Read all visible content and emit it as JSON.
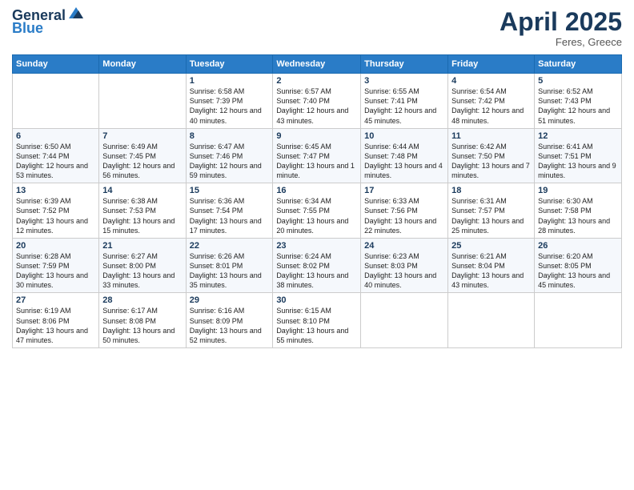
{
  "header": {
    "logo_line1": "General",
    "logo_line2": "Blue",
    "month_title": "April 2025",
    "location": "Feres, Greece"
  },
  "weekdays": [
    "Sunday",
    "Monday",
    "Tuesday",
    "Wednesday",
    "Thursday",
    "Friday",
    "Saturday"
  ],
  "rows": [
    [
      {
        "day": "",
        "info": ""
      },
      {
        "day": "",
        "info": ""
      },
      {
        "day": "1",
        "info": "Sunrise: 6:58 AM\nSunset: 7:39 PM\nDaylight: 12 hours and 40 minutes."
      },
      {
        "day": "2",
        "info": "Sunrise: 6:57 AM\nSunset: 7:40 PM\nDaylight: 12 hours and 43 minutes."
      },
      {
        "day": "3",
        "info": "Sunrise: 6:55 AM\nSunset: 7:41 PM\nDaylight: 12 hours and 45 minutes."
      },
      {
        "day": "4",
        "info": "Sunrise: 6:54 AM\nSunset: 7:42 PM\nDaylight: 12 hours and 48 minutes."
      },
      {
        "day": "5",
        "info": "Sunrise: 6:52 AM\nSunset: 7:43 PM\nDaylight: 12 hours and 51 minutes."
      }
    ],
    [
      {
        "day": "6",
        "info": "Sunrise: 6:50 AM\nSunset: 7:44 PM\nDaylight: 12 hours and 53 minutes."
      },
      {
        "day": "7",
        "info": "Sunrise: 6:49 AM\nSunset: 7:45 PM\nDaylight: 12 hours and 56 minutes."
      },
      {
        "day": "8",
        "info": "Sunrise: 6:47 AM\nSunset: 7:46 PM\nDaylight: 12 hours and 59 minutes."
      },
      {
        "day": "9",
        "info": "Sunrise: 6:45 AM\nSunset: 7:47 PM\nDaylight: 13 hours and 1 minute."
      },
      {
        "day": "10",
        "info": "Sunrise: 6:44 AM\nSunset: 7:48 PM\nDaylight: 13 hours and 4 minutes."
      },
      {
        "day": "11",
        "info": "Sunrise: 6:42 AM\nSunset: 7:50 PM\nDaylight: 13 hours and 7 minutes."
      },
      {
        "day": "12",
        "info": "Sunrise: 6:41 AM\nSunset: 7:51 PM\nDaylight: 13 hours and 9 minutes."
      }
    ],
    [
      {
        "day": "13",
        "info": "Sunrise: 6:39 AM\nSunset: 7:52 PM\nDaylight: 13 hours and 12 minutes."
      },
      {
        "day": "14",
        "info": "Sunrise: 6:38 AM\nSunset: 7:53 PM\nDaylight: 13 hours and 15 minutes."
      },
      {
        "day": "15",
        "info": "Sunrise: 6:36 AM\nSunset: 7:54 PM\nDaylight: 13 hours and 17 minutes."
      },
      {
        "day": "16",
        "info": "Sunrise: 6:34 AM\nSunset: 7:55 PM\nDaylight: 13 hours and 20 minutes."
      },
      {
        "day": "17",
        "info": "Sunrise: 6:33 AM\nSunset: 7:56 PM\nDaylight: 13 hours and 22 minutes."
      },
      {
        "day": "18",
        "info": "Sunrise: 6:31 AM\nSunset: 7:57 PM\nDaylight: 13 hours and 25 minutes."
      },
      {
        "day": "19",
        "info": "Sunrise: 6:30 AM\nSunset: 7:58 PM\nDaylight: 13 hours and 28 minutes."
      }
    ],
    [
      {
        "day": "20",
        "info": "Sunrise: 6:28 AM\nSunset: 7:59 PM\nDaylight: 13 hours and 30 minutes."
      },
      {
        "day": "21",
        "info": "Sunrise: 6:27 AM\nSunset: 8:00 PM\nDaylight: 13 hours and 33 minutes."
      },
      {
        "day": "22",
        "info": "Sunrise: 6:26 AM\nSunset: 8:01 PM\nDaylight: 13 hours and 35 minutes."
      },
      {
        "day": "23",
        "info": "Sunrise: 6:24 AM\nSunset: 8:02 PM\nDaylight: 13 hours and 38 minutes."
      },
      {
        "day": "24",
        "info": "Sunrise: 6:23 AM\nSunset: 8:03 PM\nDaylight: 13 hours and 40 minutes."
      },
      {
        "day": "25",
        "info": "Sunrise: 6:21 AM\nSunset: 8:04 PM\nDaylight: 13 hours and 43 minutes."
      },
      {
        "day": "26",
        "info": "Sunrise: 6:20 AM\nSunset: 8:05 PM\nDaylight: 13 hours and 45 minutes."
      }
    ],
    [
      {
        "day": "27",
        "info": "Sunrise: 6:19 AM\nSunset: 8:06 PM\nDaylight: 13 hours and 47 minutes."
      },
      {
        "day": "28",
        "info": "Sunrise: 6:17 AM\nSunset: 8:08 PM\nDaylight: 13 hours and 50 minutes."
      },
      {
        "day": "29",
        "info": "Sunrise: 6:16 AM\nSunset: 8:09 PM\nDaylight: 13 hours and 52 minutes."
      },
      {
        "day": "30",
        "info": "Sunrise: 6:15 AM\nSunset: 8:10 PM\nDaylight: 13 hours and 55 minutes."
      },
      {
        "day": "",
        "info": ""
      },
      {
        "day": "",
        "info": ""
      },
      {
        "day": "",
        "info": ""
      }
    ]
  ]
}
